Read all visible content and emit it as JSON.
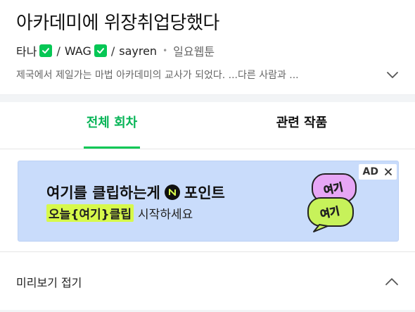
{
  "title": "아카데미에 위장취업당했다",
  "authors": [
    {
      "name": "타나",
      "verified": true
    },
    {
      "name": "WAG",
      "verified": true
    },
    {
      "name": "sayren",
      "verified": false
    }
  ],
  "separator": "/",
  "genre": "일요웹툰",
  "description": "제국에서 제일가는 마법 아카데미의 교사가 되었다. ...다른 사람과 ...",
  "tabs": [
    {
      "label": "전체 회차",
      "active": true
    },
    {
      "label": "관련 작품",
      "active": false
    }
  ],
  "ad": {
    "line1_pre": "여기를 클립하는게",
    "line1_post": "포인트",
    "line2_highlight": "오늘{여기}클립",
    "line2_rest": "시작하세요",
    "badge": "AD",
    "art_text_1": "여기",
    "art_text_2": "여기"
  },
  "preview": {
    "label": "미리보기 접기"
  },
  "colors": {
    "accent": "#06c755",
    "ad_bg": "#c9dcfb",
    "highlight": "#d7f94b"
  },
  "icons": {
    "expand": "chevron-down-icon",
    "collapse": "chevron-up-icon",
    "verified": "check-badge-icon",
    "close": "close-icon"
  }
}
